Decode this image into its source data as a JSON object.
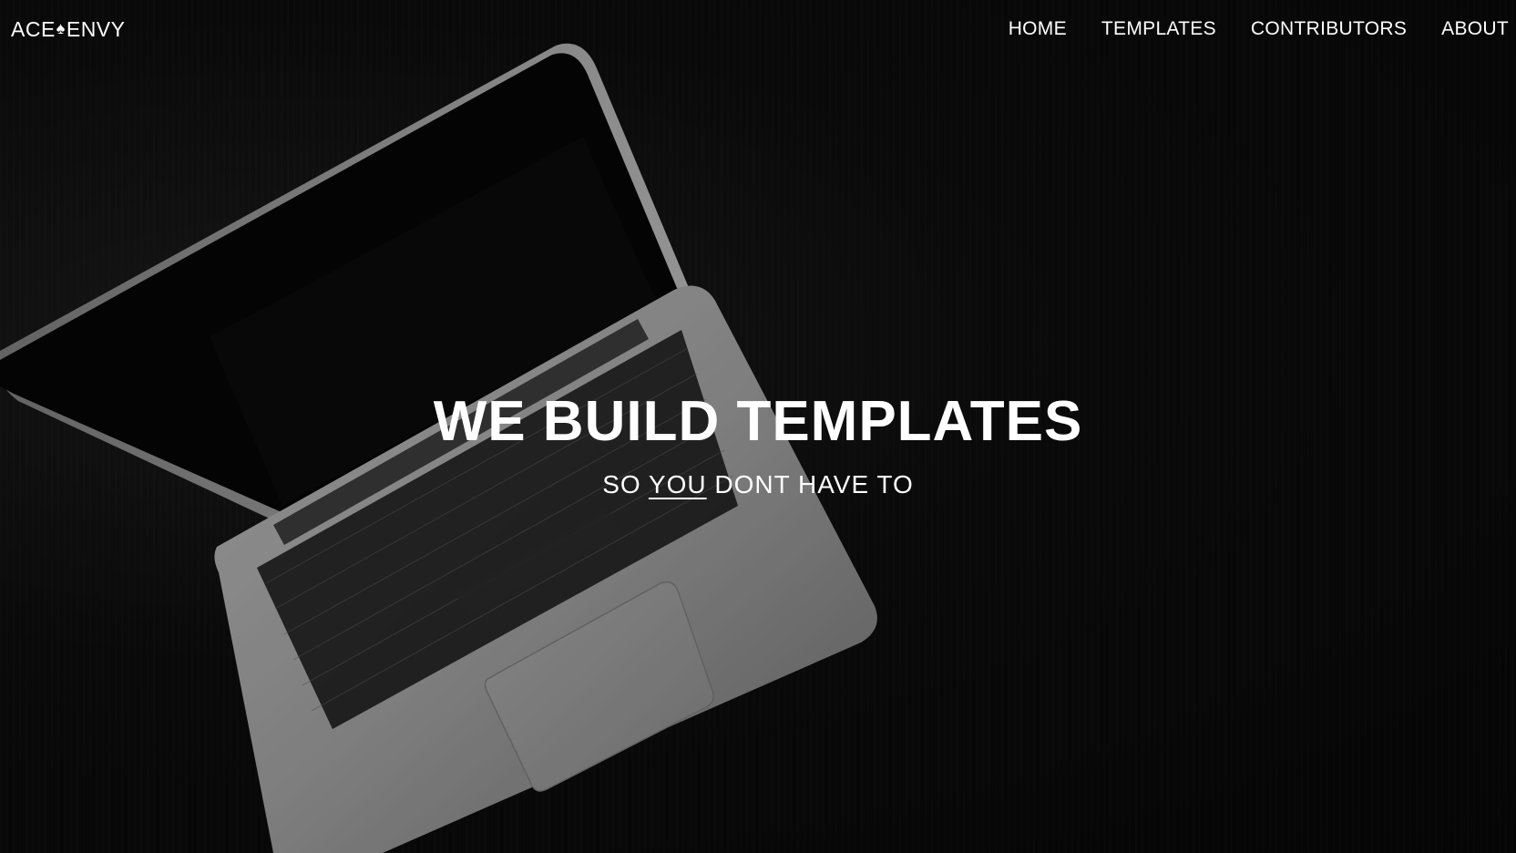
{
  "brand": {
    "part1": "ACE",
    "spade": "♠",
    "part2": "ENVY",
    "icon": "spade-icon"
  },
  "nav": {
    "items": [
      {
        "label": "HOME"
      },
      {
        "label": "TEMPLATES"
      },
      {
        "label": "CONTRIBUTORS"
      },
      {
        "label": "ABOUT"
      }
    ]
  },
  "hero": {
    "title": "WE BUILD TEMPLATES",
    "subtitle_pre": "SO ",
    "subtitle_emph": "YOU",
    "subtitle_post": " DONT HAVE TO"
  },
  "colors": {
    "background": "#0b0b0b",
    "text": "#ffffff",
    "laptop_body": "#9a9a9a",
    "screen": "#050505"
  }
}
